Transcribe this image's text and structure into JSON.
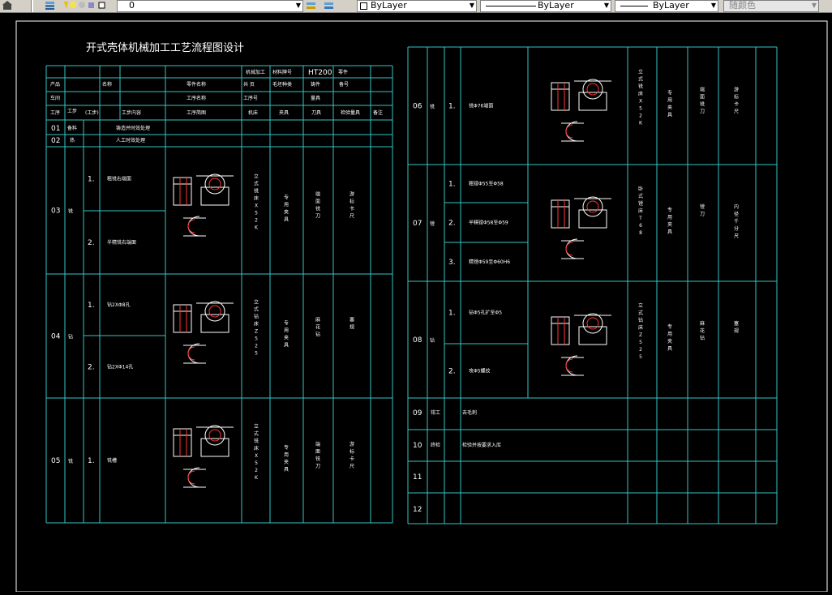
{
  "toolbar": {
    "layer_value": "0",
    "color_value": "ByLayer",
    "linetype_value": "ByLayer",
    "lineweight_value": "ByLayer",
    "plotstyle_value": "随颜色"
  },
  "drawing": {
    "title": "开式壳体机械加工工艺流程图设计",
    "material_label": "材料牌号",
    "material_value": "HT200",
    "left_rows": [
      {
        "no": "01",
        "step": "备料",
        "content": "铸造并时效处理"
      },
      {
        "no": "02",
        "step": "热",
        "content": "人工时效处理"
      },
      {
        "no": "03",
        "step": "铣",
        "subs": [
          {
            "idx": "1.",
            "text": "粗铣右端面"
          },
          {
            "idx": "2.",
            "text": "半精铣右端面"
          }
        ],
        "machine": "立式铣床X52K",
        "fixture": "专用夹具",
        "tool": "端面铣刀",
        "gauge": "游标卡尺"
      },
      {
        "no": "04",
        "step": "钻",
        "subs": [
          {
            "idx": "1.",
            "text": "钻2XΦ8孔"
          },
          {
            "idx": "2.",
            "text": "钻2XΦ14孔"
          }
        ],
        "machine": "立式钻床Z525",
        "fixture": "专用夹具",
        "tool": "麻花钻",
        "gauge": "塞规"
      },
      {
        "no": "05",
        "step": "铣",
        "subs": [
          {
            "idx": "1.",
            "text": "铣槽"
          }
        ],
        "machine": "立式铣床X52K",
        "fixture": "专用夹具",
        "tool": "端面铣刀",
        "gauge": "游标卡尺"
      }
    ],
    "right_rows": [
      {
        "no": "06",
        "step": "铣",
        "subs": [
          {
            "idx": "1.",
            "text": "铣Φ76端面"
          }
        ],
        "machine": "立式铣床X52K",
        "fixture": "专用夹具",
        "tool": "端面铣刀",
        "gauge": "游标卡尺"
      },
      {
        "no": "07",
        "step": "镗",
        "subs": [
          {
            "idx": "1.",
            "text": "粗镗Φ55至Φ58"
          },
          {
            "idx": "2.",
            "text": "半精镗Φ58至Φ59"
          },
          {
            "idx": "3.",
            "text": "精镗Φ59至Φ60H6"
          }
        ],
        "machine": "卧式镗床T68",
        "fixture": "专用夹具",
        "tool": "镗刀",
        "gauge": "内径千分尺"
      },
      {
        "no": "08",
        "step": "钻",
        "subs": [
          {
            "idx": "1.",
            "text": "钻Φ5孔扩至Φ5"
          },
          {
            "idx": "2.",
            "text": "攻Φ5螺纹"
          }
        ],
        "machine": "立式钻床Z525",
        "fixture": "专用夹具",
        "tool": "麻花钻",
        "gauge": "塞规"
      },
      {
        "no": "09",
        "step": "钳工",
        "content": "去毛刺"
      },
      {
        "no": "10",
        "step": "终检",
        "content": "检验并按要求入库"
      },
      {
        "no": "11"
      },
      {
        "no": "12"
      }
    ]
  }
}
